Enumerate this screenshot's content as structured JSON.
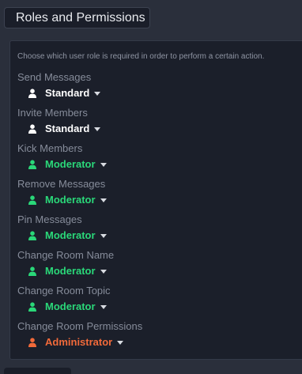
{
  "header": {
    "title": "Roles and Permissions"
  },
  "description": "Choose which user role is required in order to perform a certain action.",
  "colors": {
    "standard": "#ffffff",
    "moderator": "#2ad879",
    "administrator": "#f26a3a"
  },
  "permissions": [
    {
      "label": "Send Messages",
      "role": "Standard",
      "role_key": "standard",
      "icon": "user-icon"
    },
    {
      "label": "Invite Members",
      "role": "Standard",
      "role_key": "standard",
      "icon": "user-icon"
    },
    {
      "label": "Kick Members",
      "role": "Moderator",
      "role_key": "moderator",
      "icon": "user-icon"
    },
    {
      "label": "Remove Messages",
      "role": "Moderator",
      "role_key": "moderator",
      "icon": "user-icon"
    },
    {
      "label": "Pin Messages",
      "role": "Moderator",
      "role_key": "moderator",
      "icon": "user-icon"
    },
    {
      "label": "Change Room Name",
      "role": "Moderator",
      "role_key": "moderator",
      "icon": "user-icon"
    },
    {
      "label": "Change Room Topic",
      "role": "Moderator",
      "role_key": "moderator",
      "icon": "user-icon"
    },
    {
      "label": "Change Room Permissions",
      "role": "Administrator",
      "role_key": "administrator",
      "icon": "user-icon"
    }
  ]
}
